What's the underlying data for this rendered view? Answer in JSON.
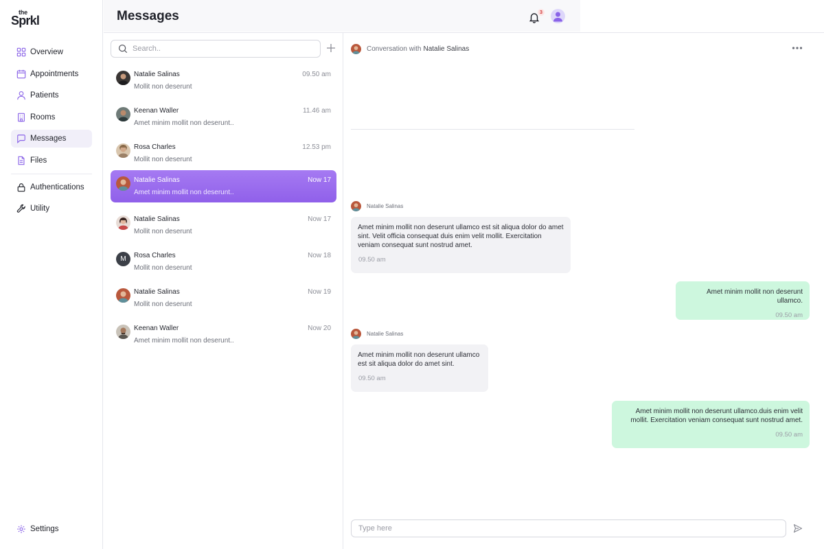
{
  "brand": {
    "logo_top": "the",
    "logo_name": "Sprkl"
  },
  "colors": {
    "accent": "#9060ea",
    "accent_light": "#f1eff9",
    "outgoing_bubble": "#cdf7de",
    "incoming_bubble": "#f2f2f5",
    "badge": "#d23b3b"
  },
  "sidebar": {
    "items": [
      {
        "label": "Overview",
        "icon": "grid-icon"
      },
      {
        "label": "Appointments",
        "icon": "calendar-icon"
      },
      {
        "label": "Patients",
        "icon": "user-icon"
      },
      {
        "label": "Rooms",
        "icon": "building-icon"
      },
      {
        "label": "Messages",
        "icon": "chat-icon",
        "active": true
      },
      {
        "label": "Files",
        "icon": "file-icon"
      },
      {
        "label": "Authentications",
        "icon": "lock-icon"
      },
      {
        "label": "Utility",
        "icon": "wrench-icon"
      }
    ],
    "settings_label": "Settings"
  },
  "header": {
    "title": "Messages",
    "notification_count": "3"
  },
  "search": {
    "placeholder": "Search.."
  },
  "conversations": [
    {
      "name": "Natalie Salinas",
      "time": "09.50 am",
      "preview": "Mollit non deserunt"
    },
    {
      "name": "Keenan Waller",
      "time": "11.46 am",
      "preview": "Amet minim mollit non deserunt.."
    },
    {
      "name": "Rosa Charles",
      "time": "12.53 pm",
      "preview": "Mollit non deserunt"
    },
    {
      "name": "Natalie Salinas",
      "time": "Now 17",
      "preview": "Amet minim mollit non deserunt..",
      "selected": true
    },
    {
      "name": "Natalie Salinas",
      "time": "Now 17",
      "preview": "Mollit non deserunt"
    },
    {
      "name": "Rosa Charles",
      "time": "Now 18",
      "preview": "Mollit non deserunt",
      "initial": "M"
    },
    {
      "name": "Natalie Salinas",
      "time": "Now 19",
      "preview": "Mollit non deserunt"
    },
    {
      "name": "Keenan Waller",
      "time": "Now 20",
      "preview": "Amet minim mollit non deserunt.."
    }
  ],
  "chat": {
    "header_prefix": "Conversation with",
    "header_name": "Natalie Salinas",
    "messages": [
      {
        "direction": "in",
        "sender": "Natalie Salinas",
        "text": "Amet minim mollit non deserunt ullamco est sit aliqua dolor do amet sint. Velit officia consequat duis enim velit mollit. Exercitation veniam consequat sunt nostrud amet.",
        "time": "09.50 am"
      },
      {
        "direction": "out",
        "text": "Amet minim mollit non deserunt ullamco.",
        "time": "09.50 am"
      },
      {
        "direction": "in",
        "sender": "Natalie Salinas",
        "text": "Amet minim mollit non deserunt ullamco est sit aliqua dolor do amet sint.",
        "time": "09.50 am"
      },
      {
        "direction": "out",
        "text": "Amet minim mollit non deserunt ullamco.duis enim velit mollit. Exercitation veniam consequat sunt nostrud amet.",
        "time": "09.50 am"
      }
    ],
    "composer_placeholder": "Type here"
  }
}
